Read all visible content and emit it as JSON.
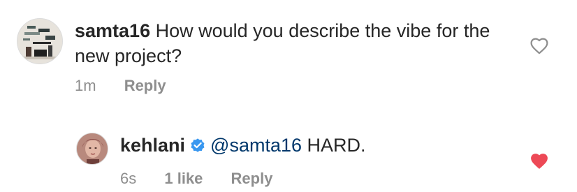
{
  "comments": [
    {
      "username": "samta16",
      "text": "How would you describe the vibe for the new project?",
      "time": "1m",
      "reply_label": "Reply",
      "liked": false,
      "avatar_icon": "user-avatar-photo"
    },
    {
      "username": "kehlani",
      "verified": true,
      "mention": "@samta16",
      "text": "HARD.",
      "time": "6s",
      "likes": "1 like",
      "reply_label": "Reply",
      "liked": true,
      "avatar_icon": "user-avatar-photo"
    }
  ],
  "colors": {
    "text": "#262626",
    "secondary": "#8e8e8e",
    "mention": "#00376b",
    "verified_blue": "#3897f0",
    "liked_red": "#ed4956"
  }
}
